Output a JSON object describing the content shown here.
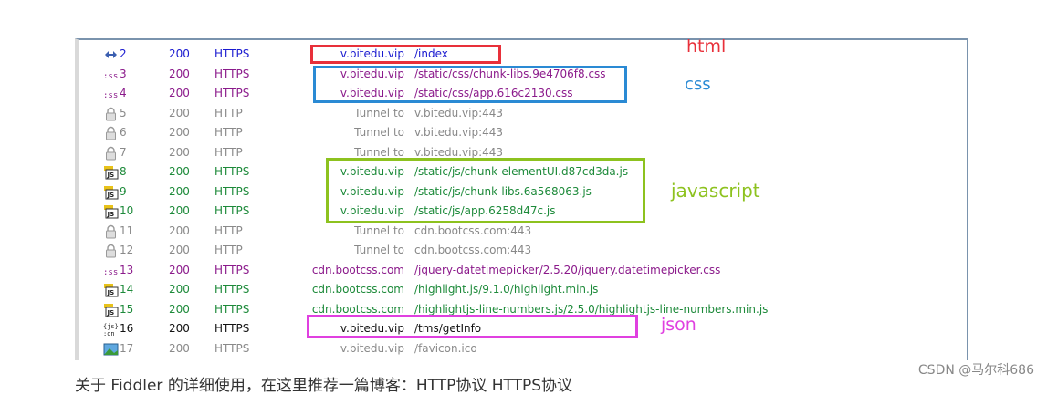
{
  "sessions": [
    {
      "num": "2",
      "result": "200",
      "protocol": "HTTPS",
      "host": "v.bitedu.vip",
      "url": "/index",
      "icon": "arrows-icon",
      "color": "blue",
      "tunnel": false
    },
    {
      "num": "3",
      "result": "200",
      "protocol": "HTTPS",
      "host": "v.bitedu.vip",
      "url": "/static/css/chunk-libs.9e4706f8.css",
      "icon": "css-icon",
      "color": "purple",
      "tunnel": false
    },
    {
      "num": "4",
      "result": "200",
      "protocol": "HTTPS",
      "host": "v.bitedu.vip",
      "url": "/static/css/app.616c2130.css",
      "icon": "css-icon",
      "color": "purple",
      "tunnel": false
    },
    {
      "num": "5",
      "result": "200",
      "protocol": "HTTP",
      "host": "Tunnel to",
      "url": "v.bitedu.vip:443",
      "icon": "lock-icon",
      "color": "gray",
      "tunnel": true
    },
    {
      "num": "6",
      "result": "200",
      "protocol": "HTTP",
      "host": "Tunnel to",
      "url": "v.bitedu.vip:443",
      "icon": "lock-icon",
      "color": "gray",
      "tunnel": true
    },
    {
      "num": "7",
      "result": "200",
      "protocol": "HTTP",
      "host": "Tunnel to",
      "url": "v.bitedu.vip:443",
      "icon": "lock-icon",
      "color": "gray",
      "tunnel": true
    },
    {
      "num": "8",
      "result": "200",
      "protocol": "HTTPS",
      "host": "v.bitedu.vip",
      "url": "/static/js/chunk-elementUI.d87cd3da.js",
      "icon": "js-icon",
      "color": "green",
      "tunnel": false
    },
    {
      "num": "9",
      "result": "200",
      "protocol": "HTTPS",
      "host": "v.bitedu.vip",
      "url": "/static/js/chunk-libs.6a568063.js",
      "icon": "js-icon",
      "color": "green",
      "tunnel": false
    },
    {
      "num": "10",
      "result": "200",
      "protocol": "HTTPS",
      "host": "v.bitedu.vip",
      "url": "/static/js/app.6258d47c.js",
      "icon": "js-icon",
      "color": "green",
      "tunnel": false
    },
    {
      "num": "11",
      "result": "200",
      "protocol": "HTTP",
      "host": "Tunnel to",
      "url": "cdn.bootcss.com:443",
      "icon": "lock-icon",
      "color": "gray",
      "tunnel": true
    },
    {
      "num": "12",
      "result": "200",
      "protocol": "HTTP",
      "host": "Tunnel to",
      "url": "cdn.bootcss.com:443",
      "icon": "lock-icon",
      "color": "gray",
      "tunnel": true
    },
    {
      "num": "13",
      "result": "200",
      "protocol": "HTTPS",
      "host": "cdn.bootcss.com",
      "url": "/jquery-datetimepicker/2.5.20/jquery.datetimepicker.css",
      "icon": "css-icon",
      "color": "purple",
      "tunnel": false
    },
    {
      "num": "14",
      "result": "200",
      "protocol": "HTTPS",
      "host": "cdn.bootcss.com",
      "url": "/highlight.js/9.1.0/highlight.min.js",
      "icon": "js-icon",
      "color": "green",
      "tunnel": false
    },
    {
      "num": "15",
      "result": "200",
      "protocol": "HTTPS",
      "host": "cdn.bootcss.com",
      "url": "/highlightjs-line-numbers.js/2.5.0/highlightjs-line-numbers.min.js",
      "icon": "js-icon",
      "color": "green",
      "tunnel": false
    },
    {
      "num": "16",
      "result": "200",
      "protocol": "HTTPS",
      "host": "v.bitedu.vip",
      "url": "/tms/getInfo",
      "icon": "json-icon",
      "color": "black",
      "tunnel": false
    },
    {
      "num": "17",
      "result": "200",
      "protocol": "HTTPS",
      "host": "v.bitedu.vip",
      "url": "/favicon.ico",
      "icon": "image-icon",
      "color": "gray",
      "tunnel": false
    }
  ],
  "annotations": {
    "html": {
      "label": "html",
      "color": "#e8303a"
    },
    "css": {
      "label": "css",
      "color": "#2a8ad4"
    },
    "javascript": {
      "label": "javascript",
      "color": "#8dc21f"
    },
    "json": {
      "label": "json",
      "color": "#e040e0"
    }
  },
  "footer_text": "关于 Fiddler 的详细使用，在这里推荐一篇博客：HTTP协议 HTTPS协议",
  "watermark": "CSDN @马尔科686"
}
